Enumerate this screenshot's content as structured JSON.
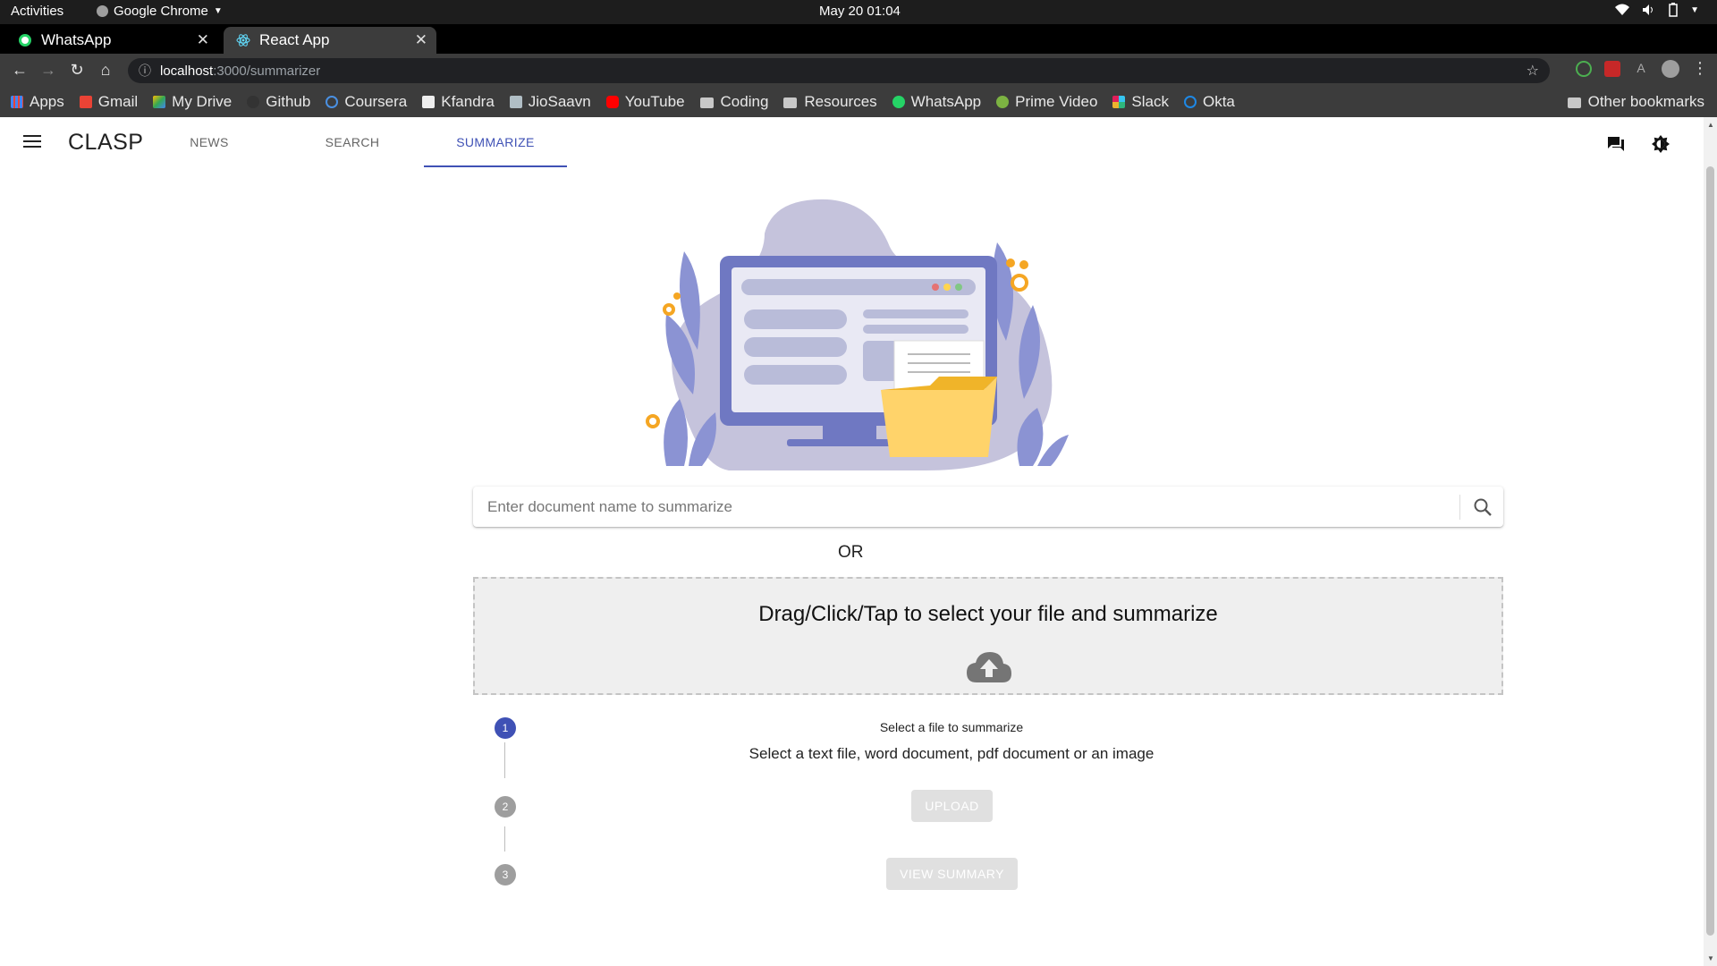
{
  "os": {
    "activities": "Activities",
    "app_name": "Google Chrome",
    "clock": "May 20  01:04"
  },
  "tabs": [
    {
      "title": "WhatsApp",
      "active": false
    },
    {
      "title": "React App",
      "active": true
    }
  ],
  "address": {
    "host": "localhost",
    "path": ":3000/summarizer"
  },
  "bookmarks": [
    {
      "label": "Apps",
      "icon": "apps-grid-icon"
    },
    {
      "label": "Gmail",
      "icon": "gmail-icon"
    },
    {
      "label": "My Drive",
      "icon": "drive-icon"
    },
    {
      "label": "Github",
      "icon": "github-icon"
    },
    {
      "label": "Coursera",
      "icon": "coursera-icon"
    },
    {
      "label": "Kfandra",
      "icon": "kfandra-icon"
    },
    {
      "label": "JioSaavn",
      "icon": "jiosaavn-icon"
    },
    {
      "label": "YouTube",
      "icon": "youtube-icon"
    },
    {
      "label": "Coding",
      "icon": "folder-icon"
    },
    {
      "label": "Resources",
      "icon": "folder-icon"
    },
    {
      "label": "WhatsApp",
      "icon": "whatsapp-icon"
    },
    {
      "label": "Prime Video",
      "icon": "prime-video-icon"
    },
    {
      "label": "Slack",
      "icon": "slack-icon"
    },
    {
      "label": "Okta",
      "icon": "okta-icon"
    }
  ],
  "other_bookmarks": "Other bookmarks",
  "app": {
    "brand": "CLASP",
    "nav": [
      "NEWS",
      "SEARCH",
      "SUMMARIZE"
    ],
    "selected_nav": "SUMMARIZE",
    "accent": "#3f51b5"
  },
  "search": {
    "placeholder": "Enter document name to summarize",
    "value": ""
  },
  "or_label": "OR",
  "dropzone": {
    "text": "Drag/Click/Tap to select your file and summarize"
  },
  "steps": [
    {
      "number": "1",
      "title": "Select a file to summarize",
      "description": "Select a text file, word document, pdf document or an image"
    },
    {
      "number": "2",
      "button": "UPLOAD"
    },
    {
      "number": "3",
      "button": "VIEW SUMMARY"
    }
  ]
}
